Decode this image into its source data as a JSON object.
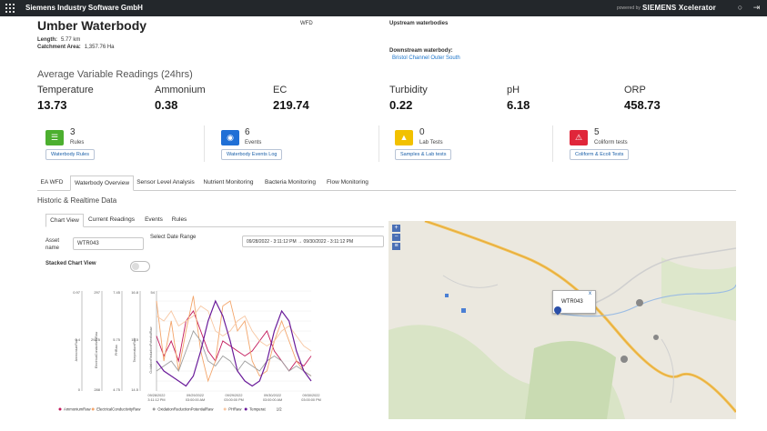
{
  "topbar": {
    "company": "Siemens Industry Software GmbH",
    "powered_by": "powered by",
    "brand": "SIEMENS Xcelerator",
    "icons": [
      "grid-menu-icon",
      "bell-icon",
      "logout-icon"
    ]
  },
  "waterbody": {
    "title": "Umber Waterbody",
    "length_label": "Length:",
    "length_value": "5.77 km",
    "catchment_label": "Catchment Area:",
    "catchment_value": "1,357.76 Ha",
    "wfd_label": "WFD",
    "upstream_label": "Upstream waterbodies",
    "downstream_label": "Downstream waterbody:",
    "downstream_value": "Bristol Channel Outer South"
  },
  "readings": {
    "title": "Average Variable Readings (24hrs)",
    "items": [
      {
        "label": "Temperature",
        "value": "13.73"
      },
      {
        "label": "Ammonium",
        "value": "0.38"
      },
      {
        "label": "EC",
        "value": "219.74"
      },
      {
        "label": "Turbidity",
        "value": "0.22"
      },
      {
        "label": "pH",
        "value": "6.18"
      },
      {
        "label": "ORP",
        "value": "458.73"
      }
    ]
  },
  "stats": [
    {
      "count": "3",
      "label": "Rules",
      "button": "Waterbody Rules",
      "color": "#4caf2f",
      "icon": "list-icon"
    },
    {
      "count": "6",
      "label": "Events",
      "button": "Waterbody Events Log",
      "color": "#1f6fd6",
      "icon": "drop-icon"
    },
    {
      "count": "0",
      "label": "Lab Tests",
      "button": "Samples & Lab tests",
      "color": "#f2c100",
      "icon": "flask-icon"
    },
    {
      "count": "5",
      "label": "Coliform tests",
      "button": "Coliform & Ecoli Tests",
      "color": "#e0263a",
      "icon": "alert-icon"
    }
  ],
  "tabs": [
    "EA WFD",
    "Waterbody Overview",
    "Sensor Level Analysis",
    "Nutrient Monitoring",
    "Bacteria Monitoring",
    "Flow Monitoring"
  ],
  "active_tab": "Waterbody Overview",
  "section": {
    "title": "Historic & Realtime Data"
  },
  "subtabs": [
    "Chart View",
    "Current Readings",
    "Events",
    "Rules"
  ],
  "asset": {
    "label": "Asset name",
    "value": "WTR043"
  },
  "date_range": {
    "label": "Select Date Range",
    "value": "09/28/2022 - 3:11:12 PM  →  09/30/2022 - 3:11:12 PM",
    "icon": "calendar-icon"
  },
  "stacked": {
    "label": "Stacked Chart View",
    "on": false
  },
  "map": {
    "popup_label": "WTR043",
    "close": "x",
    "zoom_in": "+",
    "zoom_out": "−",
    "layers": "≡"
  },
  "chart_data": {
    "type": "line",
    "x_ticks": [
      "09/28/2022\n3:11:12 PM",
      "09/29/2022\n03:00:00 AM",
      "09/29/2022\n03:00:00 PM",
      "09/30/2022\n03:00:00 AM",
      "09/30/2022\n03:00:00 PM"
    ],
    "axis_ticks": [
      {
        "name": "AmmoniumRaw",
        "top": "0.97",
        "mid": "0.4",
        "bottom": "0"
      },
      {
        "name": "ElectricalConductivityRaw",
        "top": "297",
        "mid": "292.5",
        "bottom": "288"
      },
      {
        "name": "PHRaw",
        "top": "7.45",
        "mid": "5.75",
        "bottom": "4.75"
      },
      {
        "name": "TemperatureRaw",
        "top": "16.8",
        "mid": "15.5",
        "bottom": "14.5"
      },
      {
        "name": "OxidationReductionPotentialRaw",
        "top": "54",
        "mid": "",
        "bottom": ""
      }
    ],
    "series": [
      {
        "name": "AmmoniumRaw",
        "color": "#c2185b",
        "values": [
          0.55,
          0.35,
          0.5,
          0.3,
          0.7,
          0.8,
          0.6,
          0.4,
          0.3,
          0.5,
          0.45,
          0.4,
          0.35,
          0.4,
          0.5,
          0.6,
          0.4,
          0.3,
          0.2,
          0.3,
          0.25,
          0.35
        ]
      },
      {
        "name": "ElectricalConductivityRaw",
        "color": "#f3a56b",
        "values": [
          0.9,
          0.3,
          0.7,
          0.2,
          0.6,
          0.95,
          0.4,
          0.1,
          0.3,
          0.85,
          0.9,
          0.6,
          0.7,
          0.3,
          0.15,
          0.2,
          0.5,
          0.7,
          0.5,
          0.3,
          0.2,
          0.15
        ]
      },
      {
        "name": "OxidationReductionPotentialRaw",
        "color": "#9e9e9e",
        "values": [
          0.2,
          0.25,
          0.3,
          0.2,
          0.4,
          0.6,
          0.5,
          0.3,
          0.25,
          0.35,
          0.3,
          0.2,
          0.3,
          0.25,
          0.2,
          0.3,
          0.35,
          0.3,
          0.2,
          0.25,
          0.2,
          0.15
        ]
      },
      {
        "name": "PHRaw",
        "color": "#f7c7a3",
        "values": [
          0.75,
          0.7,
          0.8,
          0.65,
          0.7,
          0.75,
          0.85,
          0.8,
          0.6,
          0.55,
          0.6,
          0.7,
          0.75,
          0.6,
          0.5,
          0.45,
          0.5,
          0.6,
          0.65,
          0.55,
          0.45,
          0.4
        ]
      },
      {
        "name": "TemperatureRaw",
        "color": "#6a1b9a",
        "values": [
          0.3,
          0.2,
          0.15,
          0.1,
          0.05,
          0.15,
          0.4,
          0.7,
          0.9,
          0.75,
          0.5,
          0.2,
          0.1,
          0.05,
          0.1,
          0.3,
          0.6,
          0.8,
          0.7,
          0.4,
          0.2,
          0.1
        ]
      }
    ],
    "legend": [
      "AmmoniumRaw",
      "ElectricalConductivityRaw",
      "OxidationReductionPotentialRaw",
      "PHRaw",
      "Temperat",
      "1/2"
    ],
    "legend_placement": "bottom",
    "grid": true
  }
}
